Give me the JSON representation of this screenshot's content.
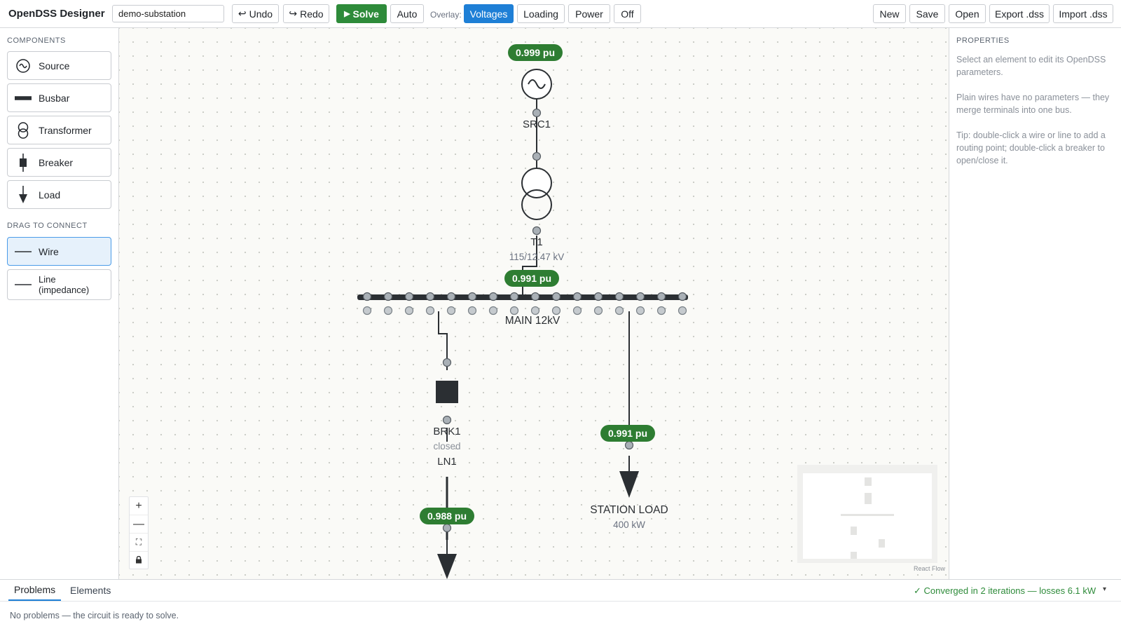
{
  "app": {
    "title": "OpenDSS Designer",
    "project_name": "demo-substation"
  },
  "toolbar": {
    "undo": "Undo",
    "redo": "Redo",
    "solve": "Solve",
    "auto": "Auto",
    "overlay_label": "Overlay:",
    "overlay_options": [
      "Voltages",
      "Loading",
      "Power",
      "Off"
    ],
    "overlay_selected": "Voltages",
    "new": "New",
    "save": "Save",
    "open": "Open",
    "export": "Export .dss",
    "import": "Import .dss"
  },
  "left_panel": {
    "components_title": "COMPONENTS",
    "components": [
      {
        "label": "Source",
        "icon": "source-icon"
      },
      {
        "label": "Busbar",
        "icon": "busbar-icon"
      },
      {
        "label": "Transformer",
        "icon": "transformer-icon"
      },
      {
        "label": "Breaker",
        "icon": "breaker-icon"
      },
      {
        "label": "Load",
        "icon": "load-icon"
      }
    ],
    "connect_title": "DRAG TO CONNECT",
    "connectors": [
      {
        "label": "Wire",
        "icon": "wire-icon",
        "selected": true
      },
      {
        "label": "Line (impedance)",
        "icon": "line-icon",
        "selected": false
      }
    ]
  },
  "diagram": {
    "source": {
      "name": "SRC1",
      "voltage": "0.999 pu"
    },
    "transformer": {
      "name": "T1",
      "rating": "115/12.47 kV"
    },
    "bus": {
      "name": "MAIN 12kV",
      "voltage": "0.991 pu"
    },
    "breaker": {
      "name": "BRK1",
      "state": "closed"
    },
    "line": {
      "name": "LN1",
      "voltage": "0.988 pu"
    },
    "station_load": {
      "name": "STATION LOAD",
      "power": "400 kW",
      "voltage": "0.991 pu"
    },
    "colors": {
      "voltage_badge": "#2e7d32",
      "wire": "#2b2f33",
      "terminal": "#a9b0b6"
    }
  },
  "canvas": {
    "attribution": "React Flow",
    "zoom_controls": [
      "zoom-in",
      "zoom-out",
      "fit-view",
      "lock"
    ]
  },
  "right_panel": {
    "title": "PROPERTIES",
    "hint1": "Select an element to edit its OpenDSS parameters.",
    "hint2": "Plain wires have no parameters — they merge terminals into one bus.",
    "hint3": "Tip: double-click a wire or line to add a routing point; double-click a breaker to open/close it."
  },
  "bottom_panel": {
    "tabs": [
      "Problems",
      "Elements"
    ],
    "active_tab": "Problems",
    "status": "✓ Converged in 2 iterations — losses 6.1 kW",
    "message": "No problems — the circuit is ready to solve."
  }
}
